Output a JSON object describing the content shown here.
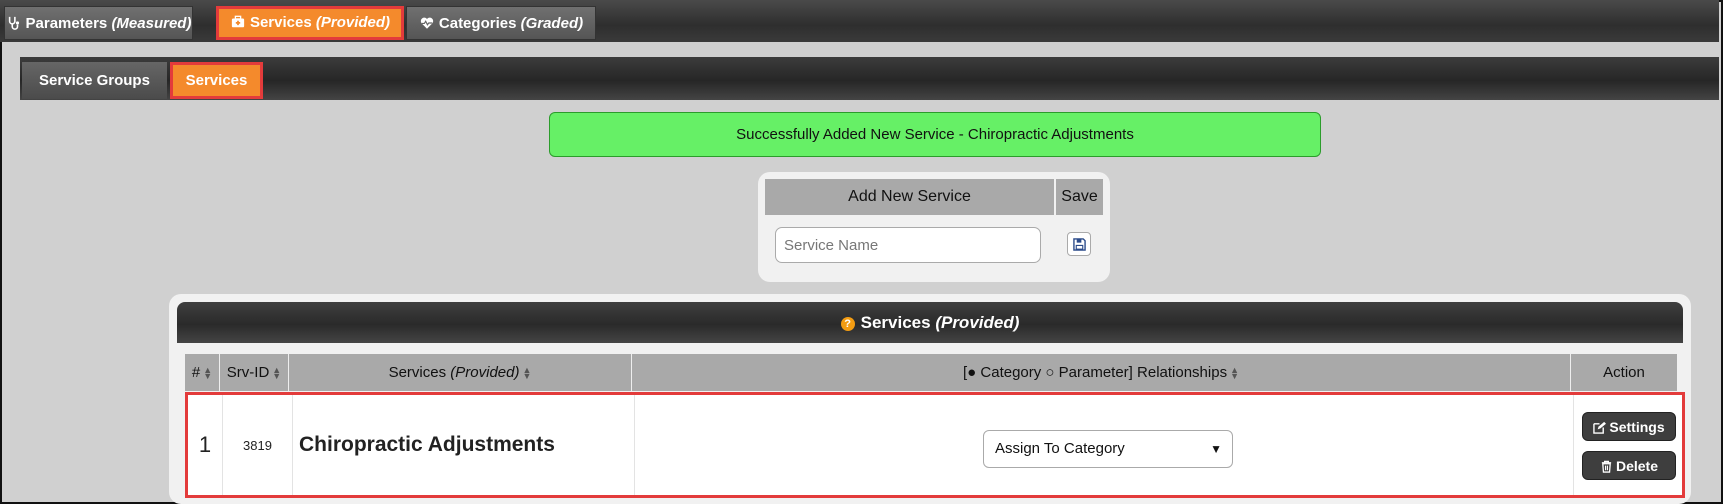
{
  "top_tabs": [
    {
      "label": "Parameters",
      "qualifier": "(Measured)",
      "icon": "stethoscope-icon"
    },
    {
      "label": "Services",
      "qualifier": "(Provided)",
      "icon": "medical-bag-icon",
      "active": true
    },
    {
      "label": "Categories",
      "qualifier": "(Graded)",
      "icon": "heart-pulse-icon"
    }
  ],
  "sub_tabs": [
    {
      "label": "Service Groups"
    },
    {
      "label": "Services",
      "active": true
    }
  ],
  "alert": {
    "message": "Successfully Added New Service - Chiropractic Adjustments",
    "color": "#66f066"
  },
  "add_form": {
    "header_name": "Add New Service",
    "header_save": "Save",
    "input_placeholder": "Service Name",
    "save_icon": "floppy-disk-icon"
  },
  "panel": {
    "title": "Services",
    "title_qualifier": "(Provided)",
    "help_icon": "question-circle-icon"
  },
  "table": {
    "columns": [
      {
        "label": "#"
      },
      {
        "label": "Srv-ID"
      },
      {
        "label": "Services",
        "qualifier": "(Provided)"
      },
      {
        "label": "[● Category ○ Parameter] Relationships"
      },
      {
        "label": "Action"
      }
    ],
    "rows": [
      {
        "index": "1",
        "srv_id": "3819",
        "service": "Chiropractic Adjustments",
        "relationship_select": "Assign To Category",
        "settings_label": "Settings",
        "delete_label": "Delete"
      }
    ]
  },
  "colors": {
    "accent": "#f48a2c",
    "highlight_border": "#e33b3b",
    "dark_bar": "#2e2e2e"
  }
}
